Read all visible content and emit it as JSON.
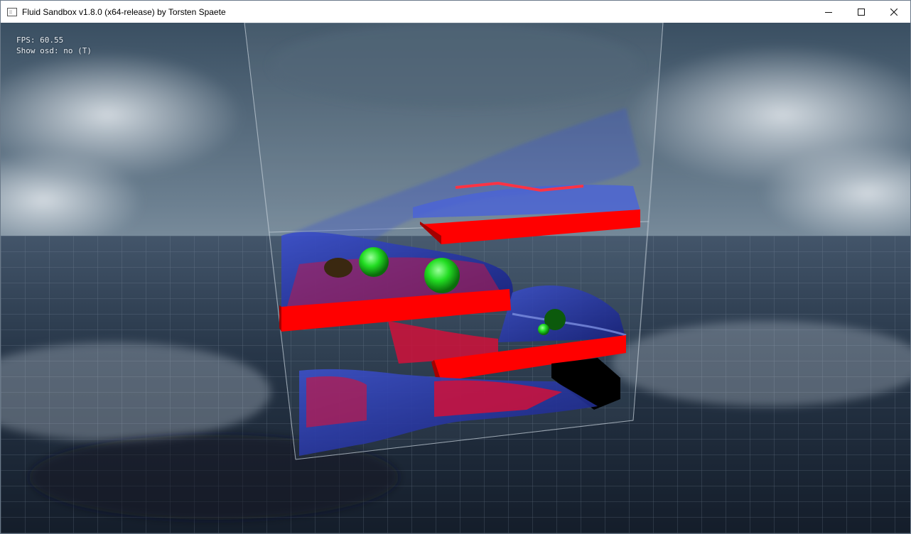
{
  "window": {
    "title": "Fluid Sandbox v1.8.0 (x64-release) by Torsten Spaete",
    "minimize_glyph": "—",
    "maximize_glyph": "☐",
    "close_glyph": "✕"
  },
  "osd": {
    "fps_line": "FPS: 60.55",
    "show_osd_line": "Show osd: no (T)"
  },
  "scene": {
    "colors": {
      "sky_top": "#3d5366",
      "sky_mid": "#7a8c9a",
      "cloud": "#c7d0d8",
      "floor": "#1c2a3c",
      "grid_line": "#7e8ea0",
      "water": "#2233a8",
      "water_light": "#7c8ee0",
      "platform_red": "#ff0000",
      "platform_dark": "#a30000",
      "sphere_green": "#22dd22",
      "glass": "#9aa9b8"
    }
  }
}
